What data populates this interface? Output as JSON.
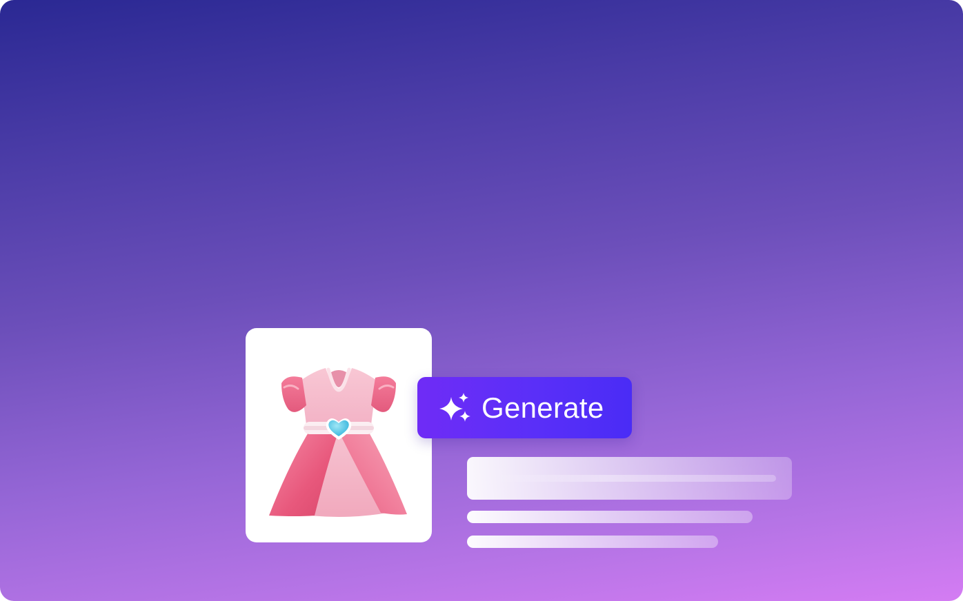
{
  "generate_button": {
    "label": "Generate",
    "icon": "sparkles-icon"
  },
  "product_image": {
    "subject": "dress-image"
  },
  "colors": {
    "background_top": "#2a2893",
    "background_bottom": "#d47cf3",
    "button_accent": "#5a2ff8",
    "dress_pink": "#f07a98",
    "heart_blue": "#4cc9e6"
  }
}
